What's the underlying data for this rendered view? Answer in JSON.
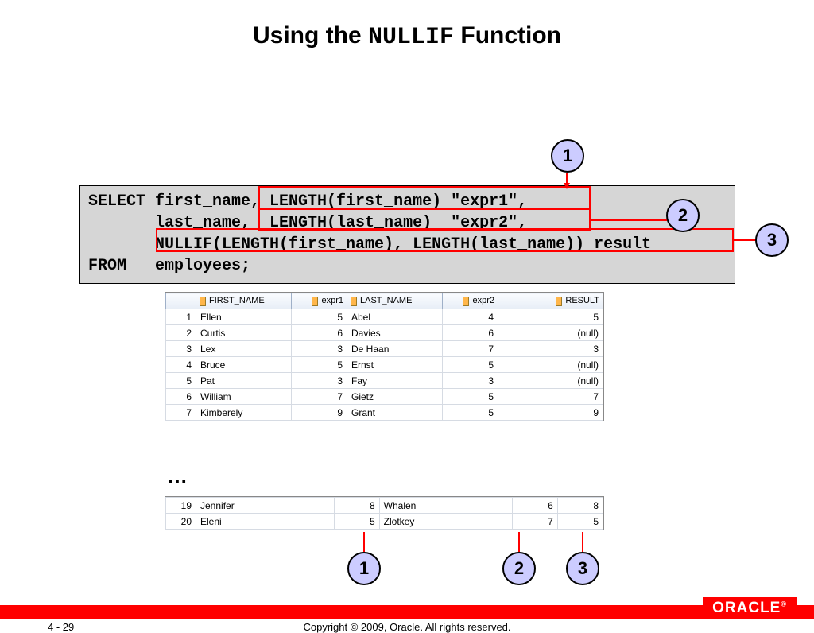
{
  "title": {
    "pre": "Using the ",
    "mono": "NULLIF",
    "post": " Function"
  },
  "sql": "SELECT first_name, LENGTH(first_name) \"expr1\",\n       last_name,  LENGTH(last_name)  \"expr2\",\n       NULLIF(LENGTH(first_name), LENGTH(last_name)) result\nFROM   employees;",
  "callouts": {
    "c1": "1",
    "c2": "2",
    "c3": "3"
  },
  "headers": {
    "rownum": "",
    "first_name": "FIRST_NAME",
    "expr1": "expr1",
    "last_name": "LAST_NAME",
    "expr2": "expr2",
    "result": "RESULT"
  },
  "rows_top": [
    {
      "n": "1",
      "first_name": "Ellen",
      "expr1": "5",
      "last_name": "Abel",
      "expr2": "4",
      "result": "5"
    },
    {
      "n": "2",
      "first_name": "Curtis",
      "expr1": "6",
      "last_name": "Davies",
      "expr2": "6",
      "result": "(null)"
    },
    {
      "n": "3",
      "first_name": "Lex",
      "expr1": "3",
      "last_name": "De Haan",
      "expr2": "7",
      "result": "3"
    },
    {
      "n": "4",
      "first_name": "Bruce",
      "expr1": "5",
      "last_name": "Ernst",
      "expr2": "5",
      "result": "(null)"
    },
    {
      "n": "5",
      "first_name": "Pat",
      "expr1": "3",
      "last_name": "Fay",
      "expr2": "3",
      "result": "(null)"
    },
    {
      "n": "6",
      "first_name": "William",
      "expr1": "7",
      "last_name": "Gietz",
      "expr2": "5",
      "result": "7"
    },
    {
      "n": "7",
      "first_name": "Kimberely",
      "expr1": "9",
      "last_name": "Grant",
      "expr2": "5",
      "result": "9"
    }
  ],
  "ellipsis": "…",
  "rows_bot": [
    {
      "n": "19",
      "first_name": "Jennifer",
      "expr1": "8",
      "last_name": "Whalen",
      "expr2": "6",
      "result": "8"
    },
    {
      "n": "20",
      "first_name": "Eleni",
      "expr1": "5",
      "last_name": "Zlotkey",
      "expr2": "7",
      "result": "5"
    }
  ],
  "footer": {
    "page": "4 - 29",
    "copyright": "Copyright © 2009, Oracle. All rights reserved.",
    "logo": "ORACLE",
    "reg": "®"
  }
}
